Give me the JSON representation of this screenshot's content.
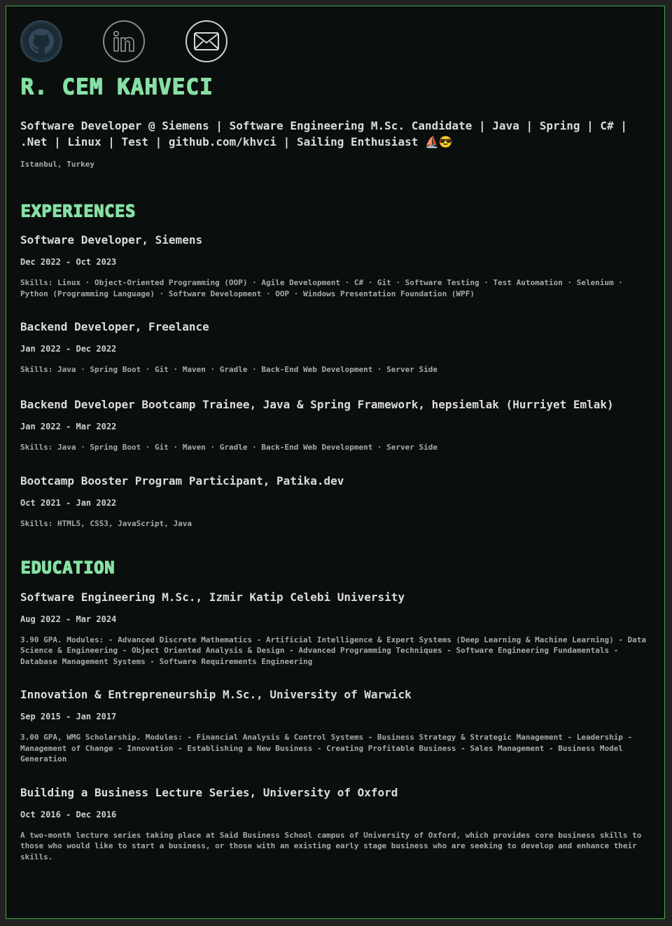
{
  "socials": [
    {
      "name": "github",
      "icon": "github-icon"
    },
    {
      "name": "linkedin",
      "icon": "linkedin-icon"
    },
    {
      "name": "email",
      "icon": "mail-icon"
    }
  ],
  "profile": {
    "name": "R. CEM KAHVECI",
    "headline": "Software Developer @ Siemens | Software Engineering M.Sc. Candidate | Java | Spring | C# | .Net | Linux | Test | github.com/khvci | Sailing Enthusiast ⛵😎",
    "location": "Istanbul, Turkey"
  },
  "experiences": {
    "title": "EXPERIENCES",
    "items": [
      {
        "title": "Software Developer, Siemens",
        "date": "Dec 2022 - Oct 2023",
        "desc": "Skills: Linux · Object-Oriented Programming (OOP) · Agile Development · C# · Git · Software Testing · Test Automation · Selenium · Python (Programming Language) · Software Development · OOP · Windows Presentation Foundation (WPF)"
      },
      {
        "title": "Backend Developer, Freelance",
        "date": "Jan 2022 - Dec 2022",
        "desc": "Skills: Java · Spring Boot · Git · Maven · Gradle · Back-End Web Development · Server Side"
      },
      {
        "title": "Backend Developer Bootcamp Trainee, Java & Spring Framework, hepsiemlak (Hurriyet Emlak)",
        "date": "Jan 2022 - Mar 2022",
        "desc": "Skills: Java · Spring Boot · Git · Maven · Gradle · Back-End Web Development · Server Side"
      },
      {
        "title": "Bootcamp Booster Program Participant, Patika.dev",
        "date": "Oct 2021 - Jan 2022",
        "desc": "Skills: HTML5, CSS3, JavaScript, Java"
      }
    ]
  },
  "education": {
    "title": "EDUCATION",
    "items": [
      {
        "title": "Software Engineering M.Sc., Izmir Katip Celebi University",
        "date": "Aug 2022 - Mar 2024",
        "desc": "3.90 GPA. Modules: - Advanced Discrete Mathematics - Artificial Intelligence & Expert Systems (Deep Learning & Machine Learning) - Data Science & Engineering - Object Oriented Analysis & Design - Advanced Programming Techniques - Software Engineering Fundamentals - Database Management Systems - Software Requirements Engineering"
      },
      {
        "title": "Innovation & Entrepreneurship M.Sc., University of Warwick",
        "date": "Sep 2015 - Jan 2017",
        "desc": "3.00 GPA, WMG Scholarship. Modules: - Financial Analysis & Control Systems - Business Strategy & Strategic Management - Leadership - Management of Change - Innovation - Establishing a New Business - Creating Profitable Business - Sales Management - Business Model Generation"
      },
      {
        "title": "Building a Business Lecture Series, University of Oxford",
        "date": "Oct 2016 - Dec 2016",
        "desc": "A two-month lecture series taking place at Said Business School campus of University of Oxford, which provides core business skills to those who would like to start a business, or those with an existing early stage business who are seeking to develop and enhance their skills."
      }
    ]
  },
  "colors": {
    "accent": "#86e0a4",
    "border": "#3fae3f",
    "background": "#0a0e0c"
  }
}
